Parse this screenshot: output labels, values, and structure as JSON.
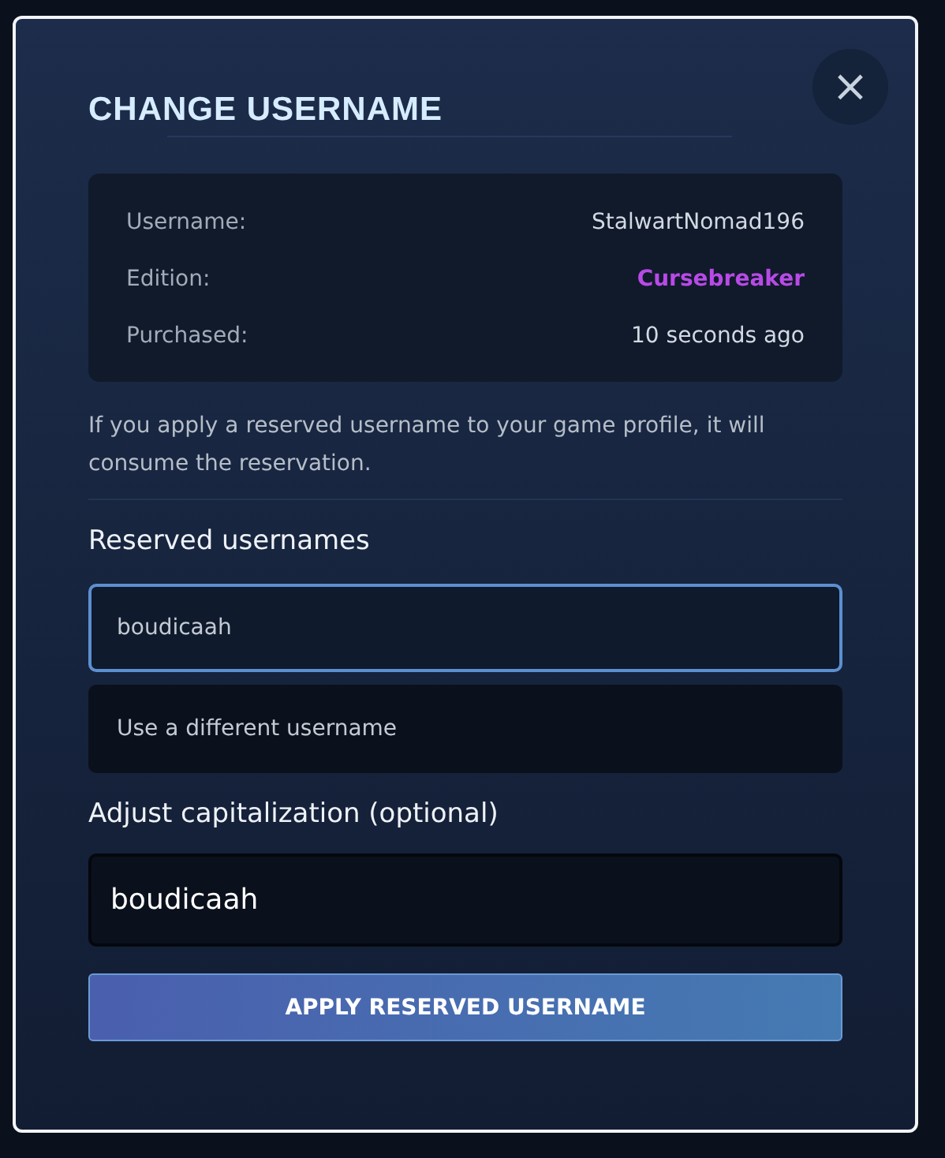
{
  "dialog": {
    "title": "CHANGE USERNAME",
    "close": "×"
  },
  "details": [
    {
      "label": "Username:",
      "value": "StalwartNomad196"
    },
    {
      "label": "Edition:",
      "value": "Cursebreaker",
      "color": "#b84ae6"
    },
    {
      "label": "Purchased:",
      "value": "10 seconds ago"
    }
  ],
  "notice": "If you apply a reserved username to your game profile, it will consume the reservation.",
  "reserved": {
    "label": "Reserved usernames",
    "options": [
      {
        "text": "boudicaah",
        "selected": true
      },
      {
        "text": "Use a different username",
        "selected": false
      }
    ]
  },
  "capitalization": {
    "label": "Adjust capitalization (optional)",
    "value": "boudicaah"
  },
  "apply_button": "APPLY RESERVED USERNAME"
}
